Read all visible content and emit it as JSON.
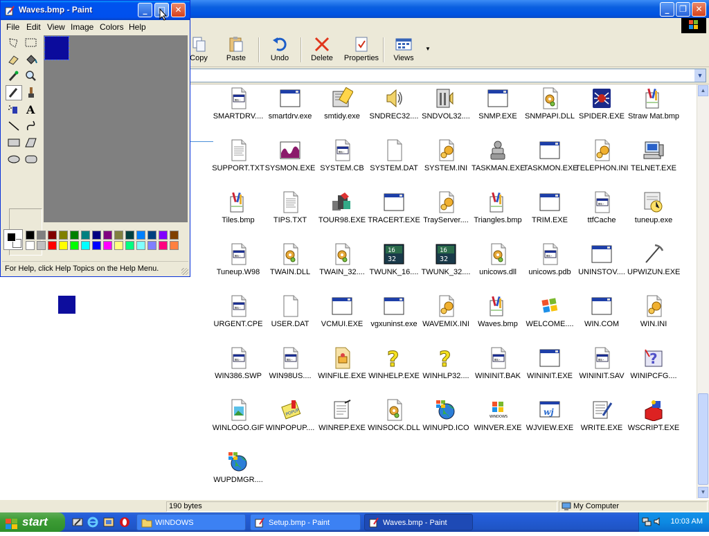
{
  "paint": {
    "title": "Waves.bmp - Paint",
    "menu": [
      "File",
      "Edit",
      "View",
      "Image",
      "Colors",
      "Help"
    ],
    "status": "For Help, click Help Topics on the Help Menu.",
    "palette_colors": [
      "#000000",
      "#808080",
      "#800000",
      "#808000",
      "#008000",
      "#008080",
      "#000080",
      "#800080",
      "#808040",
      "#004040",
      "#0080ff",
      "#004080",
      "#8000ff",
      "#804000",
      "#ffffff",
      "#c0c0c0",
      "#ff0000",
      "#ffff00",
      "#00ff00",
      "#00ffff",
      "#0000ff",
      "#ff00ff",
      "#ffff80",
      "#00ff80",
      "#80ffff",
      "#8080ff",
      "#ff0080",
      "#ff8040"
    ]
  },
  "explorer": {
    "toolbar": [
      "Copy",
      "Paste",
      "Undo",
      "Delete",
      "Properties",
      "Views"
    ],
    "status_size": "190 bytes",
    "status_location": "My Computer",
    "files": [
      {
        "name": "SMARTDRV....",
        "icon": "dos-file-icon"
      },
      {
        "name": "smartdrv.exe",
        "icon": "window-app-icon"
      },
      {
        "name": "smtidy.exe",
        "icon": "tidy-app-icon"
      },
      {
        "name": "SNDREC32....",
        "icon": "speaker-icon"
      },
      {
        "name": "SNDVOL32....",
        "icon": "volume-control-icon"
      },
      {
        "name": "SNMP.EXE",
        "icon": "window-app-icon"
      },
      {
        "name": "SNMPAPI.DLL",
        "icon": "dll-gear-icon"
      },
      {
        "name": "SPIDER.EXE",
        "icon": "spider-icon"
      },
      {
        "name": "Straw Mat.bmp",
        "icon": "paint-bitmap-icon"
      },
      {
        "name": "SUPPORT.TXT",
        "icon": "text-file-icon"
      },
      {
        "name": "SYSMON.EXE",
        "icon": "sysmon-graph-icon"
      },
      {
        "name": "SYSTEM.CB",
        "icon": "dos-file-icon"
      },
      {
        "name": "SYSTEM.DAT",
        "icon": "blank-file-icon"
      },
      {
        "name": "SYSTEM.INI",
        "icon": "settings-file-icon"
      },
      {
        "name": "TASKMAN.EXE",
        "icon": "taskman-icon"
      },
      {
        "name": "TASKMON.EXE",
        "icon": "window-app-icon"
      },
      {
        "name": "TELEPHON.INI",
        "icon": "settings-file-icon"
      },
      {
        "name": "TELNET.EXE",
        "icon": "computer-icon"
      },
      {
        "name": "Tiles.bmp",
        "icon": "paint-bitmap-icon"
      },
      {
        "name": "TIPS.TXT",
        "icon": "text-file-icon"
      },
      {
        "name": "TOUR98.EXE",
        "icon": "tour-icon"
      },
      {
        "name": "TRACERT.EXE",
        "icon": "window-app-icon"
      },
      {
        "name": "TrayServer....",
        "icon": "settings-file-icon"
      },
      {
        "name": "Triangles.bmp",
        "icon": "paint-bitmap-icon"
      },
      {
        "name": "TRIM.EXE",
        "icon": "window-app-icon"
      },
      {
        "name": "ttfCache",
        "icon": "dos-file-icon"
      },
      {
        "name": "tuneup.exe",
        "icon": "tuneup-clock-icon"
      },
      {
        "name": "Tuneup.W98",
        "icon": "dos-file-icon"
      },
      {
        "name": "TWAIN.DLL",
        "icon": "dll-gear-icon"
      },
      {
        "name": "TWAIN_32....",
        "icon": "dll-gear-icon"
      },
      {
        "name": "TWUNK_16....",
        "icon": "twunk-icon"
      },
      {
        "name": "TWUNK_32....",
        "icon": "twunk-icon"
      },
      {
        "name": "unicows.dll",
        "icon": "dll-gear-icon"
      },
      {
        "name": "unicows.pdb",
        "icon": "dos-file-icon"
      },
      {
        "name": "UNINSTOV....",
        "icon": "window-app-icon"
      },
      {
        "name": "UPWIZUN.EXE",
        "icon": "pickaxe-icon"
      },
      {
        "name": "URGENT.CPE",
        "icon": "dos-file-icon"
      },
      {
        "name": "USER.DAT",
        "icon": "blank-file-icon"
      },
      {
        "name": "VCMUI.EXE",
        "icon": "window-app-icon"
      },
      {
        "name": "vgxuninst.exe",
        "icon": "window-app-icon"
      },
      {
        "name": "WAVEMIX.INI",
        "icon": "settings-file-icon"
      },
      {
        "name": "Waves.bmp",
        "icon": "paint-bitmap-icon"
      },
      {
        "name": "WELCOME....",
        "icon": "windows-flag-icon"
      },
      {
        "name": "WIN.COM",
        "icon": "window-app-icon"
      },
      {
        "name": "WIN.INI",
        "icon": "settings-file-icon"
      },
      {
        "name": "WIN386.SWP",
        "icon": "dos-file-icon"
      },
      {
        "name": "WIN98US....",
        "icon": "dos-file-icon"
      },
      {
        "name": "WINFILE.EXE",
        "icon": "folder-file-icon"
      },
      {
        "name": "WINHELP.EXE",
        "icon": "help-question-icon"
      },
      {
        "name": "WINHLP32....",
        "icon": "help-question-icon"
      },
      {
        "name": "WININIT.BAK",
        "icon": "dos-file-icon"
      },
      {
        "name": "WININIT.EXE",
        "icon": "window-app-icon"
      },
      {
        "name": "WININIT.SAV",
        "icon": "dos-file-icon"
      },
      {
        "name": "WINIPCFG....",
        "icon": "ipcfg-icon"
      },
      {
        "name": "WINLOGO.GIF",
        "icon": "image-file-icon"
      },
      {
        "name": "WINPOPUP....",
        "icon": "winpopup-icon"
      },
      {
        "name": "WINREP.EXE",
        "icon": "report-icon"
      },
      {
        "name": "WINSOCK.DLL",
        "icon": "dll-gear-icon"
      },
      {
        "name": "WINUPD.ICO",
        "icon": "globe-icon"
      },
      {
        "name": "WINVER.EXE",
        "icon": "windows-logo-icon"
      },
      {
        "name": "WJVIEW.EXE",
        "icon": "wjview-icon"
      },
      {
        "name": "WRITE.EXE",
        "icon": "write-notepad-icon"
      },
      {
        "name": "WSCRIPT.EXE",
        "icon": "wscript-icon"
      },
      {
        "name": "WUPDMGR....",
        "icon": "globe-icon"
      }
    ]
  },
  "taskbar": {
    "start_label": "start",
    "tasks": [
      "WINDOWS",
      "Setup.bmp - Paint",
      "Waves.bmp - Paint"
    ],
    "clock": "10:03 AM"
  }
}
